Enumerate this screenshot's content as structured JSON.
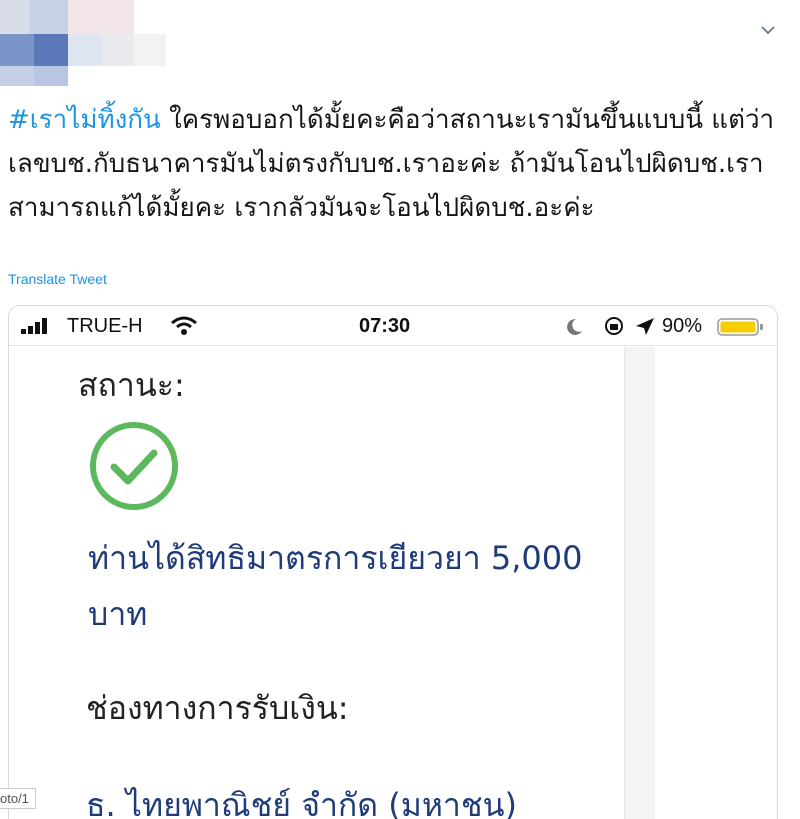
{
  "tweet": {
    "hashtag": "#เราไม่ทิ้งกัน",
    "body": " ใครพอบอกได้มั้ยคะคือว่าสถานะเรามันขึ้นแบบนี้ แต่ว่าเลขบช.กับธนาคารมันไม่ตรงกับบช.เราอะค่ะ ถ้ามันโอนไปผิดบช.เราสามารถแก้ได้มั้ยคะ เรากลัวมันจะโอนไปผิดบช.อะค่ะ",
    "translate_label": "Translate Tweet",
    "menu_icon": "chevron-down-icon"
  },
  "photo": {
    "status_bar": {
      "carrier": "TRUE-H",
      "time": "07:30",
      "battery": "90%"
    },
    "status_label": "สถานะ:",
    "grant_text": "ท่านได้สิทธิมาตรการเยียวยา 5,000 บาท",
    "channel_label": "ช่องทางการรับเงิน:",
    "bank_name": "ธ. ไทยพาณิชย์ จำกัด (มหาชน)",
    "check_color": "#5cb85c",
    "photo_tab": "oto/1"
  },
  "colors": {
    "hashtag": "#1b95e0",
    "accent_text": "#1f3b7a",
    "battery": "#f7cc00"
  }
}
